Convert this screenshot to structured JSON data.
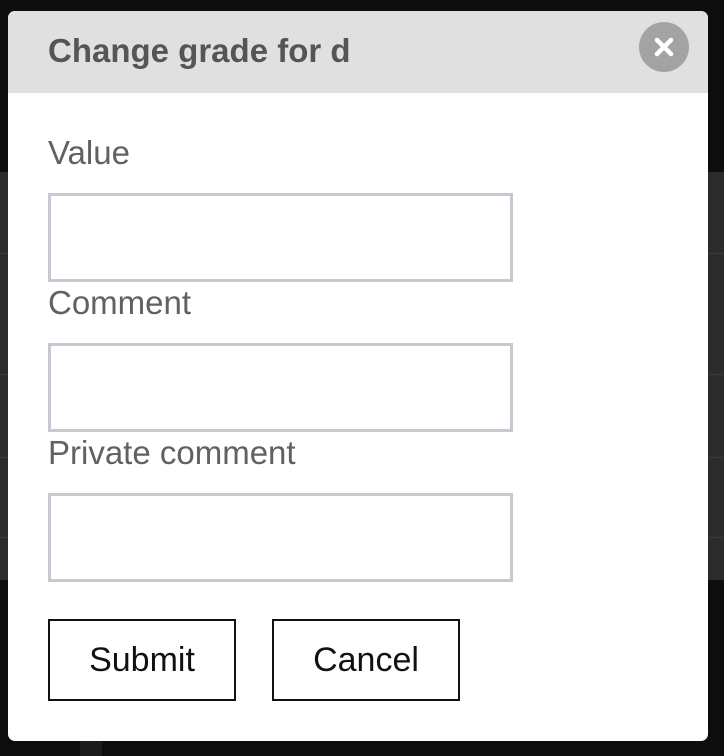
{
  "dialog": {
    "title": "Change grade for d",
    "close_icon": "close-icon",
    "fields": [
      {
        "label": "Value",
        "value": "",
        "placeholder": ""
      },
      {
        "label": "Comment",
        "value": "",
        "placeholder": ""
      },
      {
        "label": "Private comment",
        "value": "",
        "placeholder": ""
      }
    ],
    "submit_label": "Submit",
    "cancel_label": "Cancel"
  },
  "colors": {
    "overlay": "#0d0d0d",
    "header_bg": "#e0e0e0",
    "title_text": "#555555",
    "label_text": "#616161",
    "input_border": "#c9c7d2",
    "close_button_bg": "#a3a3a3"
  }
}
